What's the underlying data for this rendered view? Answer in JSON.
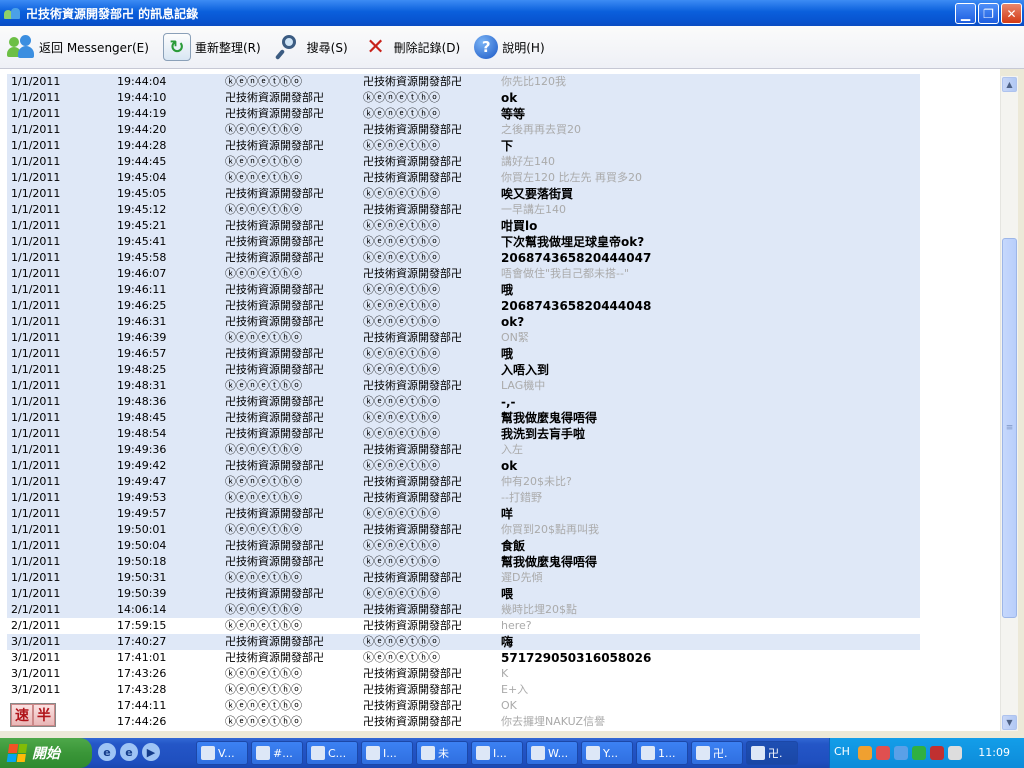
{
  "window": {
    "title": "卍技術資源開發部卍 的訊息記錄"
  },
  "toolbar": [
    {
      "icon": "messenger-icon",
      "label": "返回 Messenger(E)"
    },
    {
      "icon": "refresh-icon",
      "label": "重新整理(R)"
    },
    {
      "icon": "search-icon",
      "label": "搜尋(S)"
    },
    {
      "icon": "delete-icon",
      "label": "刪除記錄(D)"
    },
    {
      "icon": "help-icon",
      "label": "說明(H)"
    }
  ],
  "log": {
    "rows": [
      {
        "date": "1/1/2011",
        "time": "19:44:04",
        "from": "ⓚⓔⓝⓔⓣⓗⓞ",
        "to": "卍技術資源開發部卍",
        "msg": "你先比120我",
        "style": "grey"
      },
      {
        "date": "1/1/2011",
        "time": "19:44:10",
        "from": "卍技術資源開發部卍",
        "to": "ⓚⓔⓝⓔⓣⓗⓞ",
        "msg": "ok",
        "style": "bold"
      },
      {
        "date": "1/1/2011",
        "time": "19:44:19",
        "from": "卍技術資源開發部卍",
        "to": "ⓚⓔⓝⓔⓣⓗⓞ",
        "msg": "等等",
        "style": "bold"
      },
      {
        "date": "1/1/2011",
        "time": "19:44:20",
        "from": "ⓚⓔⓝⓔⓣⓗⓞ",
        "to": "卍技術資源開發部卍",
        "msg": "之後再再去買20",
        "style": "grey"
      },
      {
        "date": "1/1/2011",
        "time": "19:44:28",
        "from": "卍技術資源開發部卍",
        "to": "ⓚⓔⓝⓔⓣⓗⓞ",
        "msg": "下",
        "style": "bold"
      },
      {
        "date": "1/1/2011",
        "time": "19:44:45",
        "from": "ⓚⓔⓝⓔⓣⓗⓞ",
        "to": "卍技術資源開發部卍",
        "msg": "講好左140",
        "style": "grey"
      },
      {
        "date": "1/1/2011",
        "time": "19:45:04",
        "from": "ⓚⓔⓝⓔⓣⓗⓞ",
        "to": "卍技術資源開發部卍",
        "msg": "你買左120 比左先 再買多20",
        "style": "grey"
      },
      {
        "date": "1/1/2011",
        "time": "19:45:05",
        "from": "卍技術資源開發部卍",
        "to": "ⓚⓔⓝⓔⓣⓗⓞ",
        "msg": "唉又要落街買",
        "style": "bold"
      },
      {
        "date": "1/1/2011",
        "time": "19:45:12",
        "from": "ⓚⓔⓝⓔⓣⓗⓞ",
        "to": "卍技術資源開發部卍",
        "msg": "一早講左140",
        "style": "grey"
      },
      {
        "date": "1/1/2011",
        "time": "19:45:21",
        "from": "卍技術資源開發部卍",
        "to": "ⓚⓔⓝⓔⓣⓗⓞ",
        "msg": "咁買lo",
        "style": "bold"
      },
      {
        "date": "1/1/2011",
        "time": "19:45:41",
        "from": "卍技術資源開發部卍",
        "to": "ⓚⓔⓝⓔⓣⓗⓞ",
        "msg": "下次幫我做埋足球皇帝ok?",
        "style": "bold"
      },
      {
        "date": "1/1/2011",
        "time": "19:45:58",
        "from": "卍技術資源開發部卍",
        "to": "ⓚⓔⓝⓔⓣⓗⓞ",
        "msg": "206874365820444047",
        "style": "bold"
      },
      {
        "date": "1/1/2011",
        "time": "19:46:07",
        "from": "ⓚⓔⓝⓔⓣⓗⓞ",
        "to": "卍技術資源開發部卍",
        "msg": "唔會做住\"我自己都未搭--\"",
        "style": "grey"
      },
      {
        "date": "1/1/2011",
        "time": "19:46:11",
        "from": "卍技術資源開發部卍",
        "to": "ⓚⓔⓝⓔⓣⓗⓞ",
        "msg": "哦",
        "style": "bold"
      },
      {
        "date": "1/1/2011",
        "time": "19:46:25",
        "from": "卍技術資源開發部卍",
        "to": "ⓚⓔⓝⓔⓣⓗⓞ",
        "msg": "206874365820444048",
        "style": "bold"
      },
      {
        "date": "1/1/2011",
        "time": "19:46:31",
        "from": "卍技術資源開發部卍",
        "to": "ⓚⓔⓝⓔⓣⓗⓞ",
        "msg": "ok?",
        "style": "bold"
      },
      {
        "date": "1/1/2011",
        "time": "19:46:39",
        "from": "ⓚⓔⓝⓔⓣⓗⓞ",
        "to": "卍技術資源開發部卍",
        "msg": "ON緊",
        "style": "grey"
      },
      {
        "date": "1/1/2011",
        "time": "19:46:57",
        "from": "卍技術資源開發部卍",
        "to": "ⓚⓔⓝⓔⓣⓗⓞ",
        "msg": "哦",
        "style": "bold"
      },
      {
        "date": "1/1/2011",
        "time": "19:48:25",
        "from": "卍技術資源開發部卍",
        "to": "ⓚⓔⓝⓔⓣⓗⓞ",
        "msg": "入唔入到",
        "style": "bold"
      },
      {
        "date": "1/1/2011",
        "time": "19:48:31",
        "from": "ⓚⓔⓝⓔⓣⓗⓞ",
        "to": "卍技術資源開發部卍",
        "msg": "LAG機中",
        "style": "grey"
      },
      {
        "date": "1/1/2011",
        "time": "19:48:36",
        "from": "卍技術資源開發部卍",
        "to": "ⓚⓔⓝⓔⓣⓗⓞ",
        "msg": "-,-",
        "style": "bold"
      },
      {
        "date": "1/1/2011",
        "time": "19:48:45",
        "from": "卍技術資源開發部卍",
        "to": "ⓚⓔⓝⓔⓣⓗⓞ",
        "msg": "幫我做麼鬼得唔得",
        "style": "bold"
      },
      {
        "date": "1/1/2011",
        "time": "19:48:54",
        "from": "卍技術資源開發部卍",
        "to": "ⓚⓔⓝⓔⓣⓗⓞ",
        "msg": "我洗到去肓手啦",
        "style": "bold"
      },
      {
        "date": "1/1/2011",
        "time": "19:49:36",
        "from": "ⓚⓔⓝⓔⓣⓗⓞ",
        "to": "卍技術資源開發部卍",
        "msg": "入左",
        "style": "grey"
      },
      {
        "date": "1/1/2011",
        "time": "19:49:42",
        "from": "卍技術資源開發部卍",
        "to": "ⓚⓔⓝⓔⓣⓗⓞ",
        "msg": "ok",
        "style": "bold"
      },
      {
        "date": "1/1/2011",
        "time": "19:49:47",
        "from": "ⓚⓔⓝⓔⓣⓗⓞ",
        "to": "卍技術資源開發部卍",
        "msg": "仲有20$未比?",
        "style": "grey"
      },
      {
        "date": "1/1/2011",
        "time": "19:49:53",
        "from": "ⓚⓔⓝⓔⓣⓗⓞ",
        "to": "卍技術資源開發部卍",
        "msg": "--打錯野",
        "style": "grey"
      },
      {
        "date": "1/1/2011",
        "time": "19:49:57",
        "from": "卍技術資源開發部卍",
        "to": "ⓚⓔⓝⓔⓣⓗⓞ",
        "msg": "咩",
        "style": "bold"
      },
      {
        "date": "1/1/2011",
        "time": "19:50:01",
        "from": "ⓚⓔⓝⓔⓣⓗⓞ",
        "to": "卍技術資源開發部卍",
        "msg": "你買到20$點再叫我",
        "style": "grey"
      },
      {
        "date": "1/1/2011",
        "time": "19:50:04",
        "from": "卍技術資源開發部卍",
        "to": "ⓚⓔⓝⓔⓣⓗⓞ",
        "msg": "食飯",
        "style": "bold"
      },
      {
        "date": "1/1/2011",
        "time": "19:50:18",
        "from": "卍技術資源開發部卍",
        "to": "ⓚⓔⓝⓔⓣⓗⓞ",
        "msg": "幫我做麼鬼得唔得",
        "style": "bold"
      },
      {
        "date": "1/1/2011",
        "time": "19:50:31",
        "from": "ⓚⓔⓝⓔⓣⓗⓞ",
        "to": "卍技術資源開發部卍",
        "msg": "遲D先傾",
        "style": "grey"
      },
      {
        "date": "1/1/2011",
        "time": "19:50:39",
        "from": "卍技術資源開發部卍",
        "to": "ⓚⓔⓝⓔⓣⓗⓞ",
        "msg": "喂",
        "style": "bold"
      },
      {
        "date": "2/1/2011",
        "time": "14:06:14",
        "from": "ⓚⓔⓝⓔⓣⓗⓞ",
        "to": "卍技術資源開發部卍",
        "msg": "幾時比埋20$點",
        "style": "grey"
      },
      {
        "date": "2/1/2011",
        "time": "17:59:15",
        "from": "ⓚⓔⓝⓔⓣⓗⓞ",
        "to": "卍技術資源開發部卍",
        "msg": "here?",
        "style": "grey"
      },
      {
        "date": "3/1/2011",
        "time": "17:40:27",
        "from": "卍技術資源開發部卍",
        "to": "ⓚⓔⓝⓔⓣⓗⓞ",
        "msg": "嗨",
        "style": "bold"
      },
      {
        "date": "3/1/2011",
        "time": "17:41:01",
        "from": "卍技術資源開發部卍",
        "to": "ⓚⓔⓝⓔⓣⓗⓞ",
        "msg": "571729050316058026",
        "style": "bold"
      },
      {
        "date": "3/1/2011",
        "time": "17:43:26",
        "from": "ⓚⓔⓝⓔⓣⓗⓞ",
        "to": "卍技術資源開發部卍",
        "msg": "K",
        "style": "grey"
      },
      {
        "date": "3/1/2011",
        "time": "17:43:28",
        "from": "ⓚⓔⓝⓔⓣⓗⓞ",
        "to": "卍技術資源開發部卍",
        "msg": "E+入",
        "style": "grey"
      },
      {
        "date": "",
        "time": "17:44:11",
        "from": "ⓚⓔⓝⓔⓣⓗⓞ",
        "to": "卍技術資源開發部卍",
        "msg": "OK",
        "style": "grey"
      },
      {
        "date": "",
        "time": "17:44:26",
        "from": "ⓚⓔⓝⓔⓣⓗⓞ",
        "to": "卍技術資源開發部卍",
        "msg": "你去攞埋NAKUZ信譽",
        "style": "grey"
      }
    ],
    "selected_count": 34,
    "selected_also": [
      35
    ]
  },
  "ime": {
    "left": "速",
    "right": "半"
  },
  "taskbar": {
    "start_label": "開始",
    "quick_launch": [
      "e",
      "e",
      "▶"
    ],
    "tasks": [
      {
        "label": "V..."
      },
      {
        "label": "#..."
      },
      {
        "label": "C..."
      },
      {
        "label": "I..."
      },
      {
        "label": "未"
      },
      {
        "label": "I..."
      },
      {
        "label": "W..."
      },
      {
        "label": "Y..."
      },
      {
        "label": "1..."
      },
      {
        "label": "卍."
      },
      {
        "label": "卍.",
        "active": true
      }
    ],
    "tray_label": "CH",
    "clock": "11:09"
  }
}
